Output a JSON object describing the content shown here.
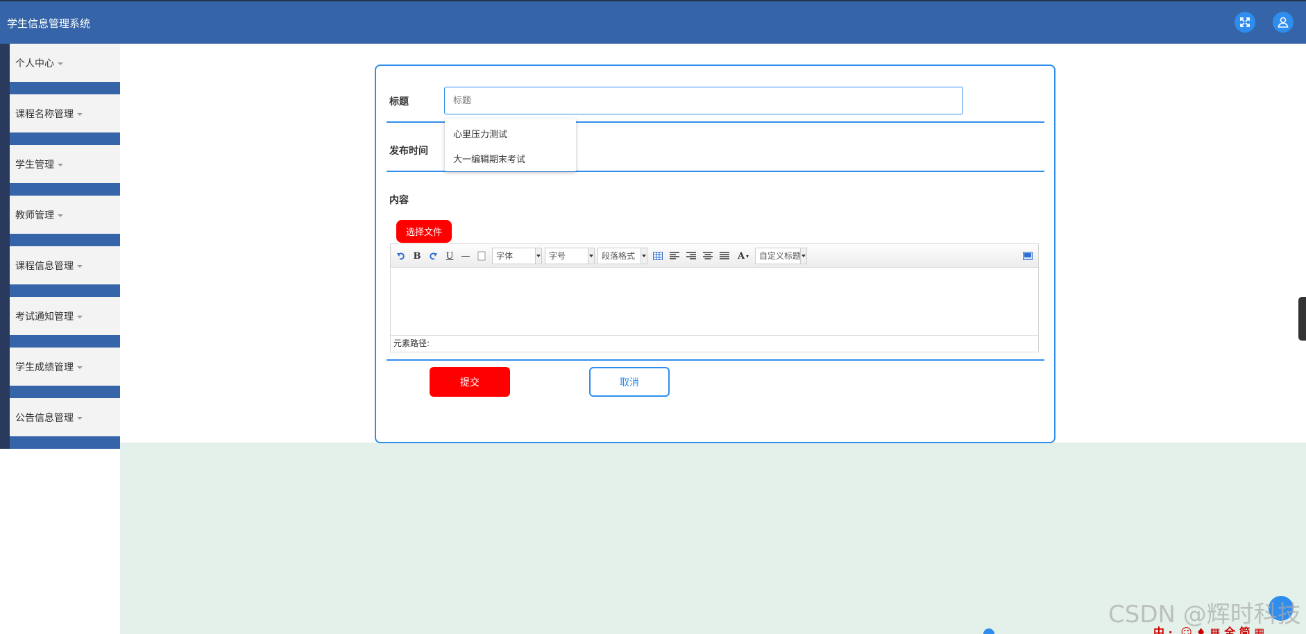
{
  "app": {
    "title": "学生信息管理系统"
  },
  "header": {
    "fullscreen_icon": "fullscreen-icon",
    "user_icon": "user-icon",
    "accent": "#3565a8"
  },
  "sidebar": {
    "items": [
      {
        "label": "个人中心"
      },
      {
        "label": "课程名称管理"
      },
      {
        "label": "学生管理"
      },
      {
        "label": "教师管理"
      },
      {
        "label": "课程信息管理"
      },
      {
        "label": "考试通知管理"
      },
      {
        "label": "学生成绩管理"
      },
      {
        "label": "公告信息管理"
      }
    ]
  },
  "form": {
    "title_label": "标题",
    "title_placeholder": "标题",
    "title_value": "",
    "suggestions": [
      "心里压力测试",
      "大一编辑期末考试"
    ],
    "publish_label": "发布时间",
    "content_label": "内容",
    "file_button": "选择文件",
    "editor": {
      "font_select": "字体",
      "size_select": "字号",
      "paragraph_select": "段落格式",
      "custom_title_select": "自定义标题",
      "status_text": "元素路径:"
    },
    "submit_label": "提交",
    "cancel_label": "取消"
  },
  "overlay": {
    "watermark": "CSDN @辉时科技",
    "ime_text": "中 ·, ☺ ♦ ▦ 全 简 ▦"
  }
}
